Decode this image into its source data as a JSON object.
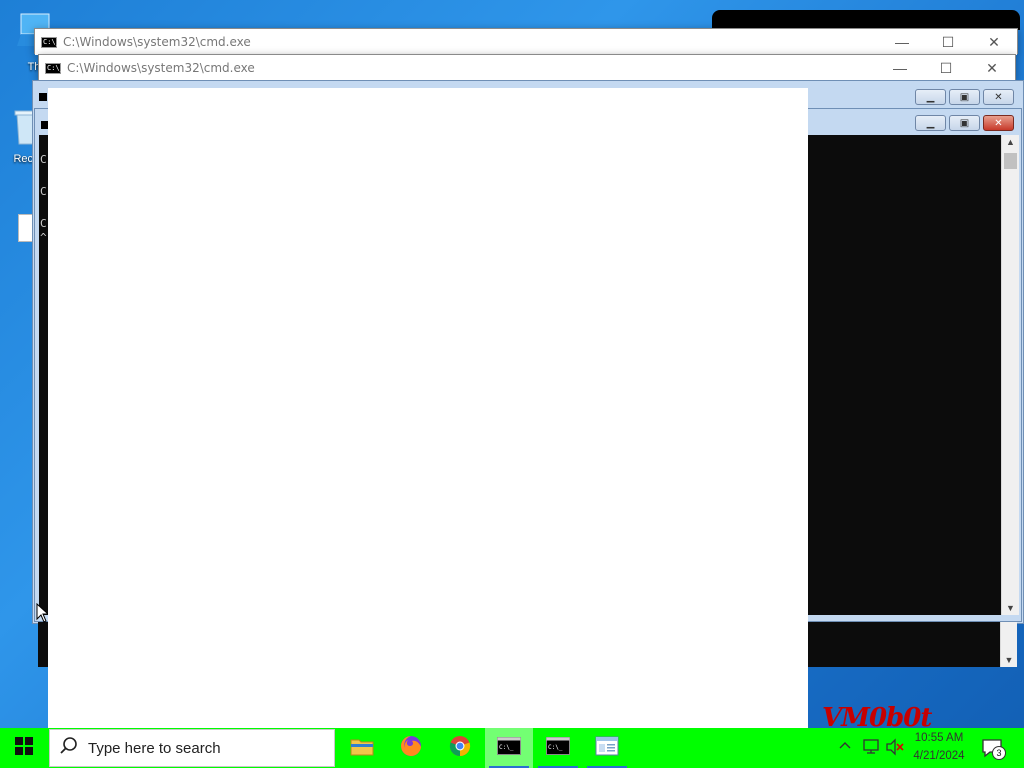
{
  "desktop": {
    "icons": [
      {
        "label": "Th",
        "name": "this-pc"
      },
      {
        "label": "Recy",
        "name": "recycle-bin"
      }
    ],
    "watermark": "VM0b0t"
  },
  "windows": {
    "cmd_front": {
      "title": "C:\\Windows\\system32\\cmd.exe",
      "icon_text": "C:\\_"
    },
    "cmd_second": {
      "title": "C:\\Windows\\system32\\cmd.exe",
      "icon_text": "C:\\_"
    },
    "cmd_classic_a": {
      "title": ""
    },
    "cmd_classic_b": {
      "title": "",
      "lines": [
        "C",
        "C",
        "C",
        "^"
      ]
    }
  },
  "controls": {
    "minimize": "—",
    "maximize": "☐",
    "close": "✕"
  },
  "taskbar": {
    "search_placeholder": "Type here to search",
    "apps": [
      {
        "name": "file-explorer"
      },
      {
        "name": "firefox"
      },
      {
        "name": "chrome"
      },
      {
        "name": "command-prompt-1"
      },
      {
        "name": "command-prompt-2"
      },
      {
        "name": "notepad-window"
      }
    ],
    "time": "10:55 AM",
    "date": "4/21/2024",
    "notification_count": "3"
  },
  "colors": {
    "taskbar": "#00ff00",
    "desktop": "#1e7fd6",
    "console": "#0c0c0c",
    "watermark": "#c60000"
  }
}
